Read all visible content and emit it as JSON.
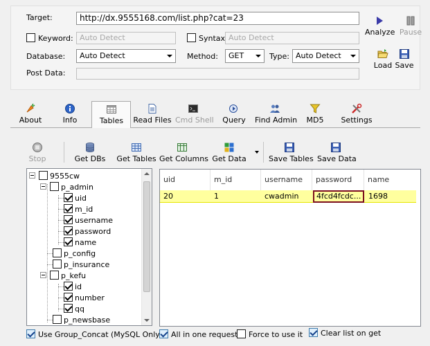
{
  "form": {
    "target_label": "Target:",
    "target_value": "http://dx.9555168.com/list.php?cat=23",
    "keyword_label": "Keyword:",
    "keyword_placeholder": "Auto Detect",
    "syntax_label": "Syntax:",
    "syntax_placeholder": "Auto Detect",
    "database_label": "Database:",
    "database_value": "Auto Detect",
    "method_label": "Method:",
    "method_value": "GET",
    "type_label": "Type:",
    "type_value": "Auto Detect",
    "postdata_label": "Post Data:"
  },
  "side_buttons": {
    "analyze": "Analyze",
    "pause": "Pause",
    "load": "Load",
    "save": "Save"
  },
  "tabs": [
    "About",
    "Info",
    "Tables",
    "Read Files",
    "Cmd Shell",
    "Query",
    "Find Admin",
    "MD5",
    "Settings"
  ],
  "toolbar": {
    "stop": "Stop",
    "get_dbs": "Get DBs",
    "get_tables": "Get Tables",
    "get_columns": "Get Columns",
    "get_data": "Get Data",
    "save_tables": "Save Tables",
    "save_data": "Save Data"
  },
  "tree": {
    "db": "9555cw",
    "nodes": [
      "p_admin",
      "uid",
      "m_id",
      "username",
      "password",
      "name",
      "p_config",
      "p_insurance",
      "p_kefu",
      "id",
      "number",
      "qq",
      "p_newsbase"
    ]
  },
  "grid": {
    "columns": [
      "uid",
      "m_id",
      "username",
      "password",
      "name"
    ],
    "row": [
      "20",
      "1",
      "cwadmin",
      "4fcd4fcdc...",
      "1698"
    ]
  },
  "bottom": {
    "group_concat": "Use Group_Concat (MySQL Only)",
    "all_in_one": "All in one request.",
    "force": "Force to use it",
    "clear_list": "Clear list on get"
  },
  "colors": {
    "selected_row": "#ffff9e",
    "focus_cell_border": "#7b0e1d"
  }
}
